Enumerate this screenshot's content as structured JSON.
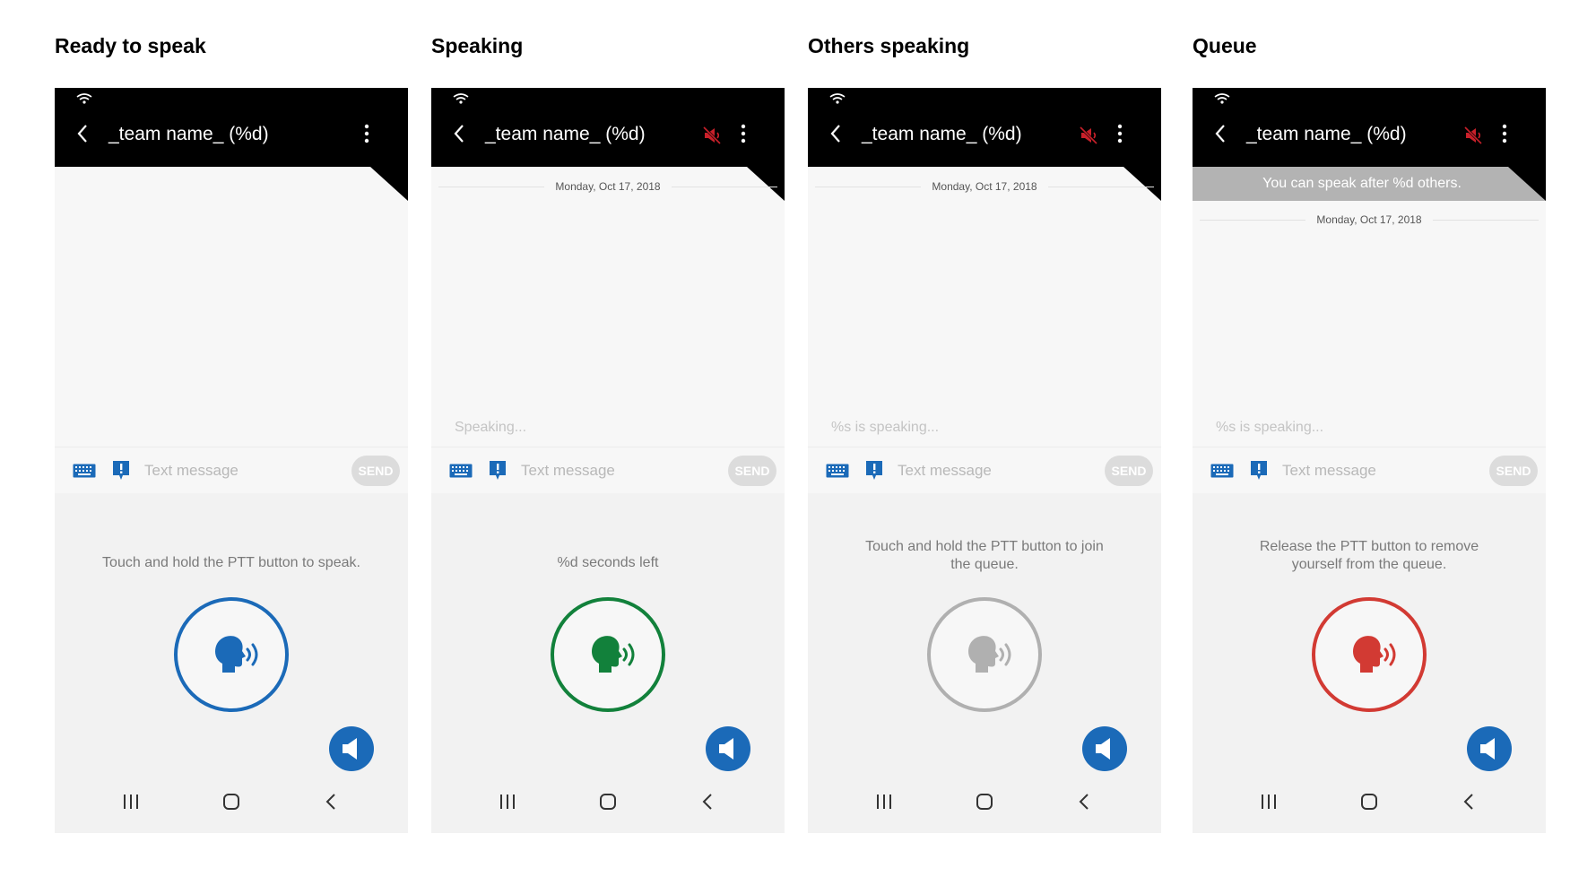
{
  "colors": {
    "blue": "#1b6ab8",
    "green": "#12813b",
    "gray": "#b0b0b0",
    "red": "#d23a33",
    "mute_red": "#c8202a"
  },
  "panels": [
    {
      "title": "Ready to speak",
      "team_name": "_team name_ (%d)",
      "date": "",
      "queue_banner": "",
      "status": "",
      "message_placeholder": "Text message",
      "send_label": "SEND",
      "ptt_hint": "Touch and hold the PTT button to speak.",
      "ptt_state": "ready"
    },
    {
      "title": "Speaking",
      "team_name": "_team name_ (%d)",
      "date": "Monday, Oct 17, 2018",
      "queue_banner": "",
      "status": "Speaking...",
      "message_placeholder": "Text message",
      "send_label": "SEND",
      "ptt_hint": "%d seconds left",
      "ptt_state": "speaking"
    },
    {
      "title": "Others speaking",
      "team_name": "_team name_ (%d)",
      "date": "Monday, Oct 17, 2018",
      "queue_banner": "",
      "status": "%s is speaking...",
      "message_placeholder": "Text message",
      "send_label": "SEND",
      "ptt_hint": "Touch and hold the PTT button to join\nthe queue.",
      "ptt_state": "others"
    },
    {
      "title": "Queue",
      "team_name": "_team name_ (%d)",
      "date": "Monday, Oct 17, 2018",
      "queue_banner": "You can speak after %d others.",
      "status": "%s is speaking...",
      "message_placeholder": "Text message",
      "send_label": "SEND",
      "ptt_hint": "Release the PTT button to remove\nyourself from the queue.",
      "ptt_state": "queue"
    }
  ],
  "icons": {
    "status": "wifi-icon",
    "back": "back-arrow-icon",
    "mute": "muted-speaker-icon",
    "menu": "more-vertical-icon",
    "keyboard": "keyboard-icon",
    "alert": "alert-message-icon",
    "ptt": "speaking-head-icon",
    "speaker": "speaker-icon",
    "nav": [
      "recent-apps-icon",
      "home-icon",
      "nav-back-icon"
    ]
  }
}
